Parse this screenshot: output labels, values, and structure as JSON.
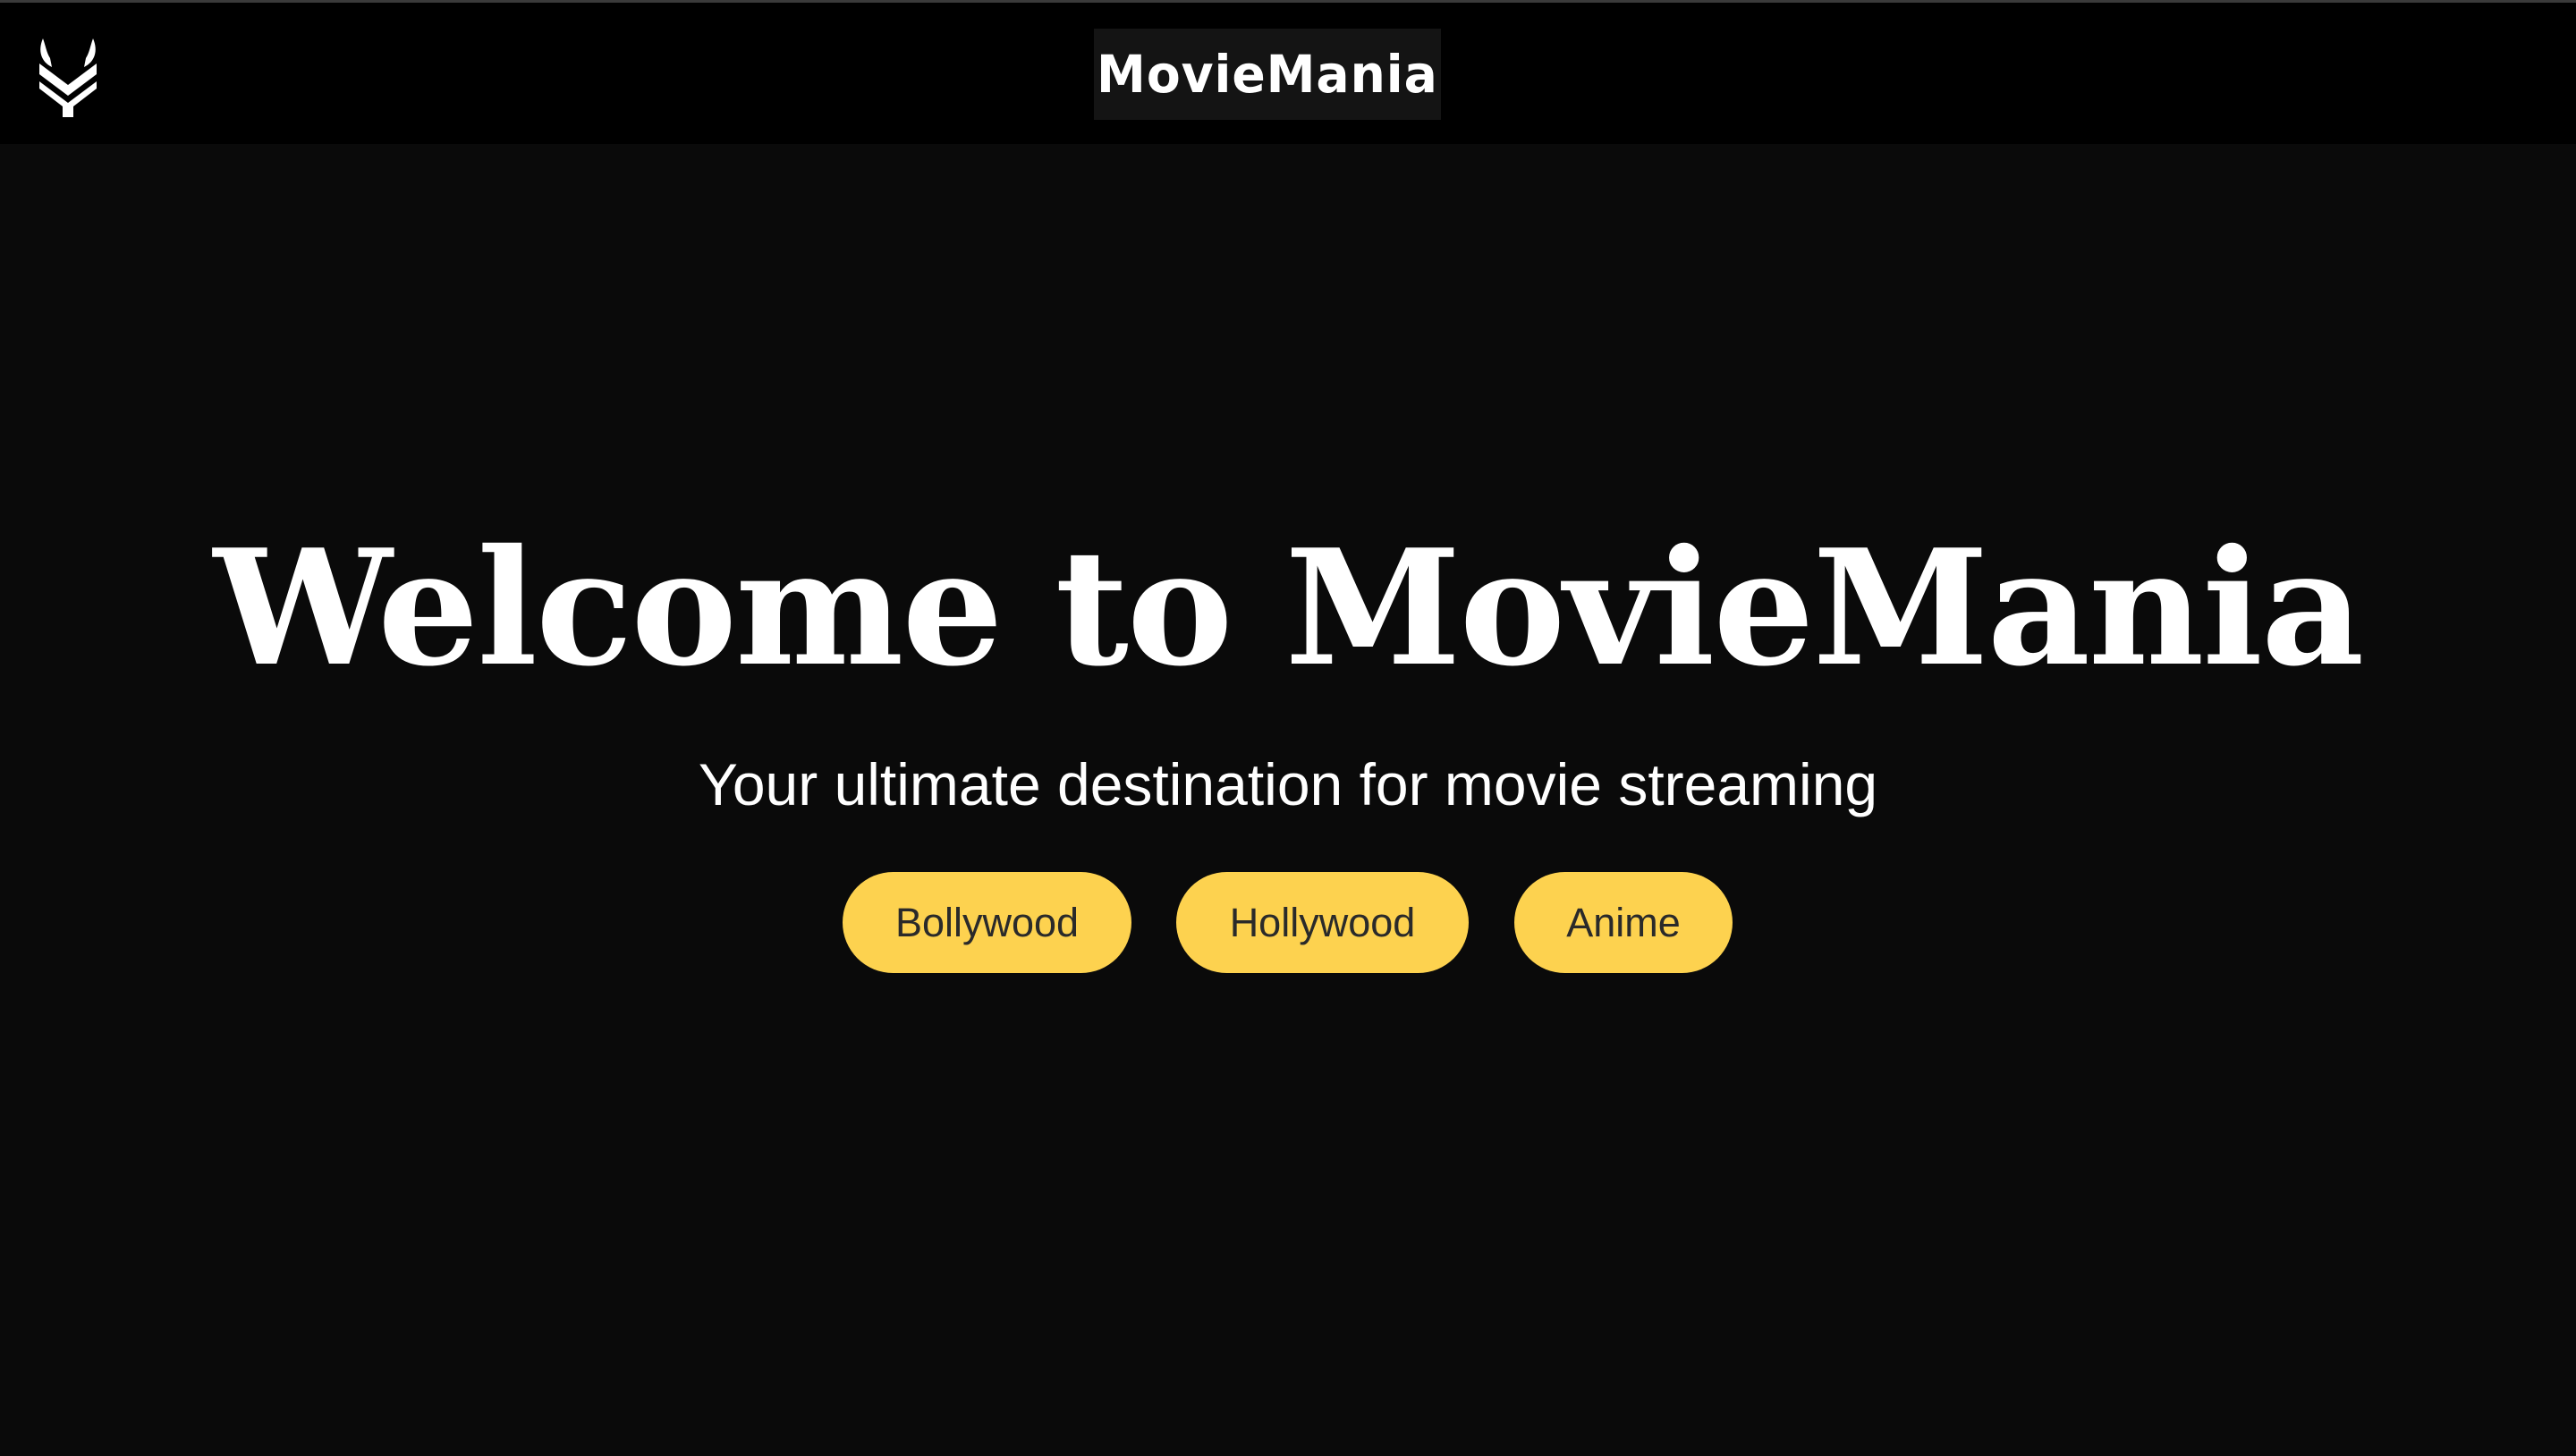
{
  "navbar": {
    "logo_icon": "horned-shield-logo-icon",
    "brand": "MovieMania"
  },
  "hero": {
    "title": "Welcome to MovieMania",
    "subtitle": "Your ultimate destination for movie streaming",
    "buttons": [
      {
        "label": "Bollywood"
      },
      {
        "label": "Hollywood"
      },
      {
        "label": "Anime"
      }
    ]
  },
  "colors": {
    "background": "#0a0a0a",
    "navbar": "#000000",
    "accent": "#fdd24f",
    "button_text": "#2a2a2a",
    "text": "#ffffff"
  }
}
